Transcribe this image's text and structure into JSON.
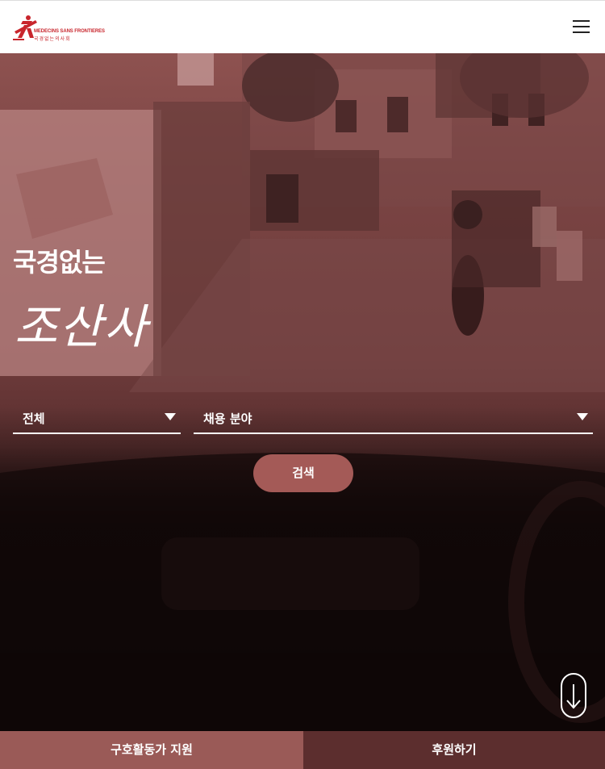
{
  "header": {
    "logo": {
      "name_en": "MEDECINS SANS FRONTIERES",
      "name_ko": "국경없는의사회"
    },
    "menu_icon": "hamburger-menu-icon"
  },
  "hero": {
    "title": "국경없는",
    "subtitle": "조산사",
    "filters": {
      "region": {
        "selected": "전체"
      },
      "field": {
        "selected": "채용 분야"
      }
    },
    "search_label": "검색",
    "scroll_icon": "arrow-down-icon"
  },
  "bottom_bar": {
    "volunteer_label": "구호활동가 지원",
    "donate_label": "후원하기"
  },
  "colors": {
    "brand_red": "#c8252c",
    "hero_tint": "#8e5250",
    "search_button": "#a45a57",
    "volunteer_bg": "#9a5a57",
    "donate_bg": "#5c2e2e"
  }
}
